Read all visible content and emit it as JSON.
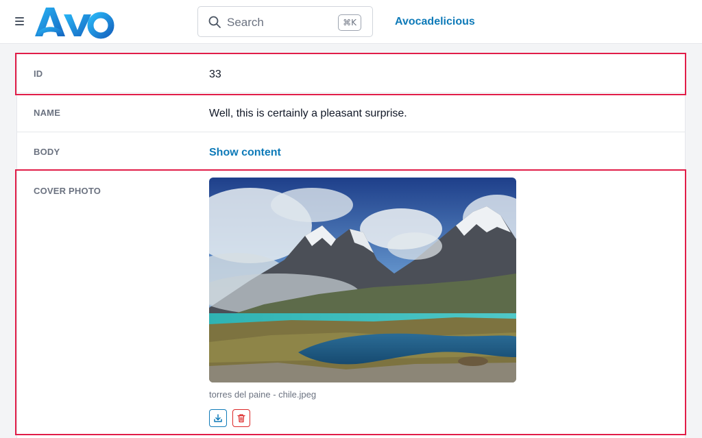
{
  "topbar": {
    "logo_text": "Avo",
    "search": {
      "placeholder": "Search",
      "shortcut": "⌘K"
    },
    "app_name": "Avocadelicious"
  },
  "record": {
    "fields": [
      {
        "label": "ID",
        "value": "33"
      },
      {
        "label": "NAME",
        "value": "Well, this is certainly a pleasant surprise."
      },
      {
        "label": "BODY",
        "value": "Show content"
      },
      {
        "label": "COVER PHOTO",
        "filename": "torres del paine - chile.jpeg"
      }
    ]
  },
  "colors": {
    "accent": "#0e7ab8",
    "logo_blue": "#1e88e5",
    "highlight": "#e11d48",
    "danger": "#dc2626"
  },
  "icons": [
    "hamburger-icon",
    "search-icon",
    "download-icon",
    "trash-icon"
  ]
}
